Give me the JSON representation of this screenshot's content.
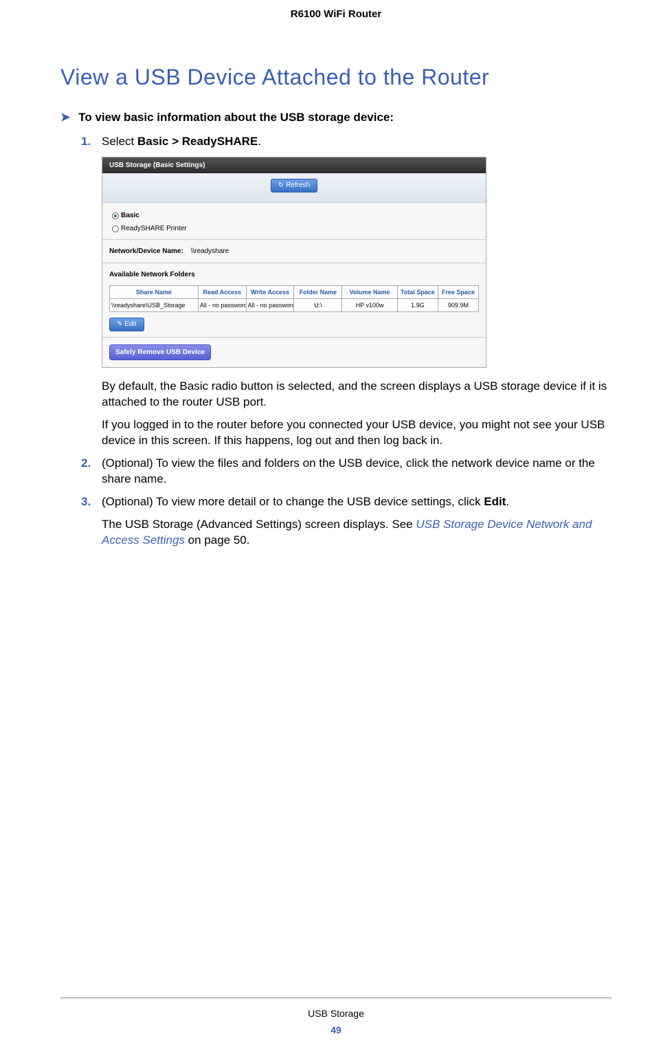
{
  "page_header": "R6100 WiFi Router",
  "section_title": "View a USB Device Attached to the Router",
  "proc_intro": "To view basic information about the USB storage device:",
  "steps": [
    {
      "num": "1.",
      "lead": "Select ",
      "bold": "Basic > ReadySHARE",
      "tail": ".",
      "paras": [
        "By default, the Basic radio button is selected, and the screen displays a USB storage device if it is attached to the router USB port.",
        "If you logged in to the router before you connected your USB device, you might not see your USB device in this screen. If this happens, log out and then log back in."
      ]
    },
    {
      "num": "2.",
      "text": "(Optional) To view the files and folders on the USB device, click the network device name or the share name."
    },
    {
      "num": "3.",
      "lead": "(Optional) To view more detail or to change the USB device settings, click ",
      "bold": "Edit",
      "tail": ".",
      "para_lead": "The USB Storage (Advanced Settings) screen displays. See ",
      "para_link": "USB Storage Device Network and Access Settings",
      "para_tail": " on page 50."
    }
  ],
  "screenshot": {
    "title": "USB Storage (Basic Settings)",
    "refresh_btn": "Refresh",
    "radio_basic": "Basic",
    "radio_printer": "ReadySHARE Printer",
    "device_label": "Network/Device Name:",
    "device_value": "\\\\readyshare",
    "folders_label": "Available Network Folders",
    "headers": [
      "Share Name",
      "Read Access",
      "Write Access",
      "Folder Name",
      "Volume Name",
      "Total Space",
      "Free Space"
    ],
    "row": [
      "\\\\readyshare\\USB_Storage",
      "All - no password",
      "All - no password",
      "U:\\",
      "HP v100w",
      "1.9G",
      "909.9M"
    ],
    "edit_btn": "Edit",
    "safely_btn": "Safely Remove USB Device"
  },
  "footer": {
    "title": "USB Storage",
    "page": "49"
  }
}
